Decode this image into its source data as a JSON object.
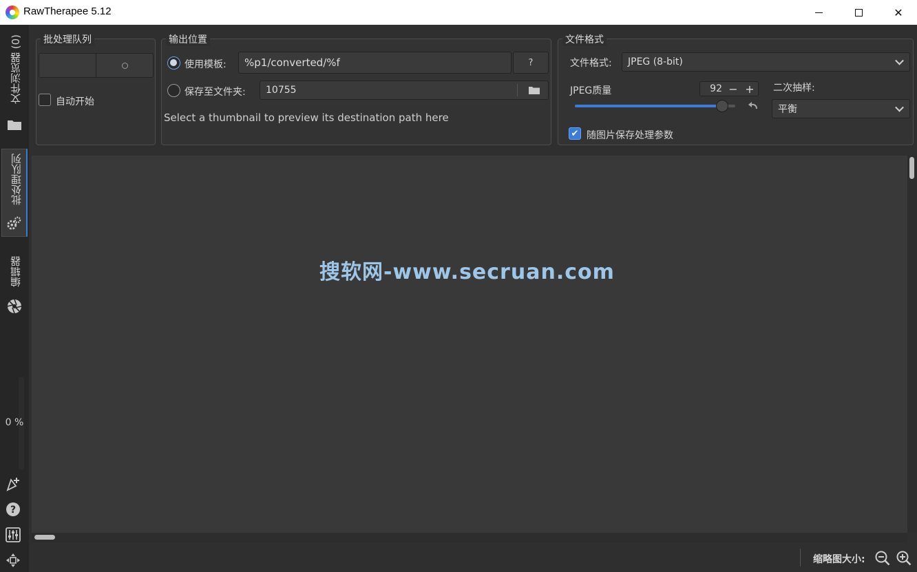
{
  "window": {
    "title": "RawTherapee 5.12",
    "minimize_label": "",
    "maximize_label": "",
    "close_label": "✕"
  },
  "sidebar": {
    "tabs": [
      {
        "label": "文件浏览器 (0)",
        "icon": "folder-icon"
      },
      {
        "label": "批处理队列",
        "icon": "gears-icon",
        "active": true
      },
      {
        "label": "编辑器",
        "icon": "aperture-icon"
      }
    ],
    "progress_text": "0 %",
    "bottom_icons": [
      "new-editor-icon",
      "help-icon",
      "preferences-icon",
      "fullscreen-icon"
    ]
  },
  "queue_panel": {
    "legend": "批处理队列",
    "auto_start_label": "自动开始",
    "auto_start_checked": false
  },
  "output_panel": {
    "legend": "输出位置",
    "use_template_label": "使用模板:",
    "template_value": "%p1/converted/%f",
    "help_button_label": "?",
    "save_to_folder_label": "保存至文件夹:",
    "folder_value": "10755",
    "hint": "Select a thumbnail to preview its destination path here"
  },
  "format_panel": {
    "legend": "文件格式",
    "format_label": "文件格式:",
    "format_value": "JPEG (8-bit)",
    "quality_label": "JPEG质量",
    "quality_value": "92",
    "quality_fraction": 0.92,
    "minus_label": "−",
    "plus_label": "+",
    "subsampling_label": "二次抽样:",
    "subsampling_value": "平衡",
    "save_params_label": "随图片保存处理参数",
    "save_params_checked": true
  },
  "main": {
    "watermark": "搜软网-www.secruan.com"
  },
  "bottom": {
    "thumbnail_size_label": "缩略图大小:"
  },
  "colors": {
    "accent": "#3d7bd8",
    "background": "#2f2f2f",
    "watermark": "#9dc6e8"
  }
}
